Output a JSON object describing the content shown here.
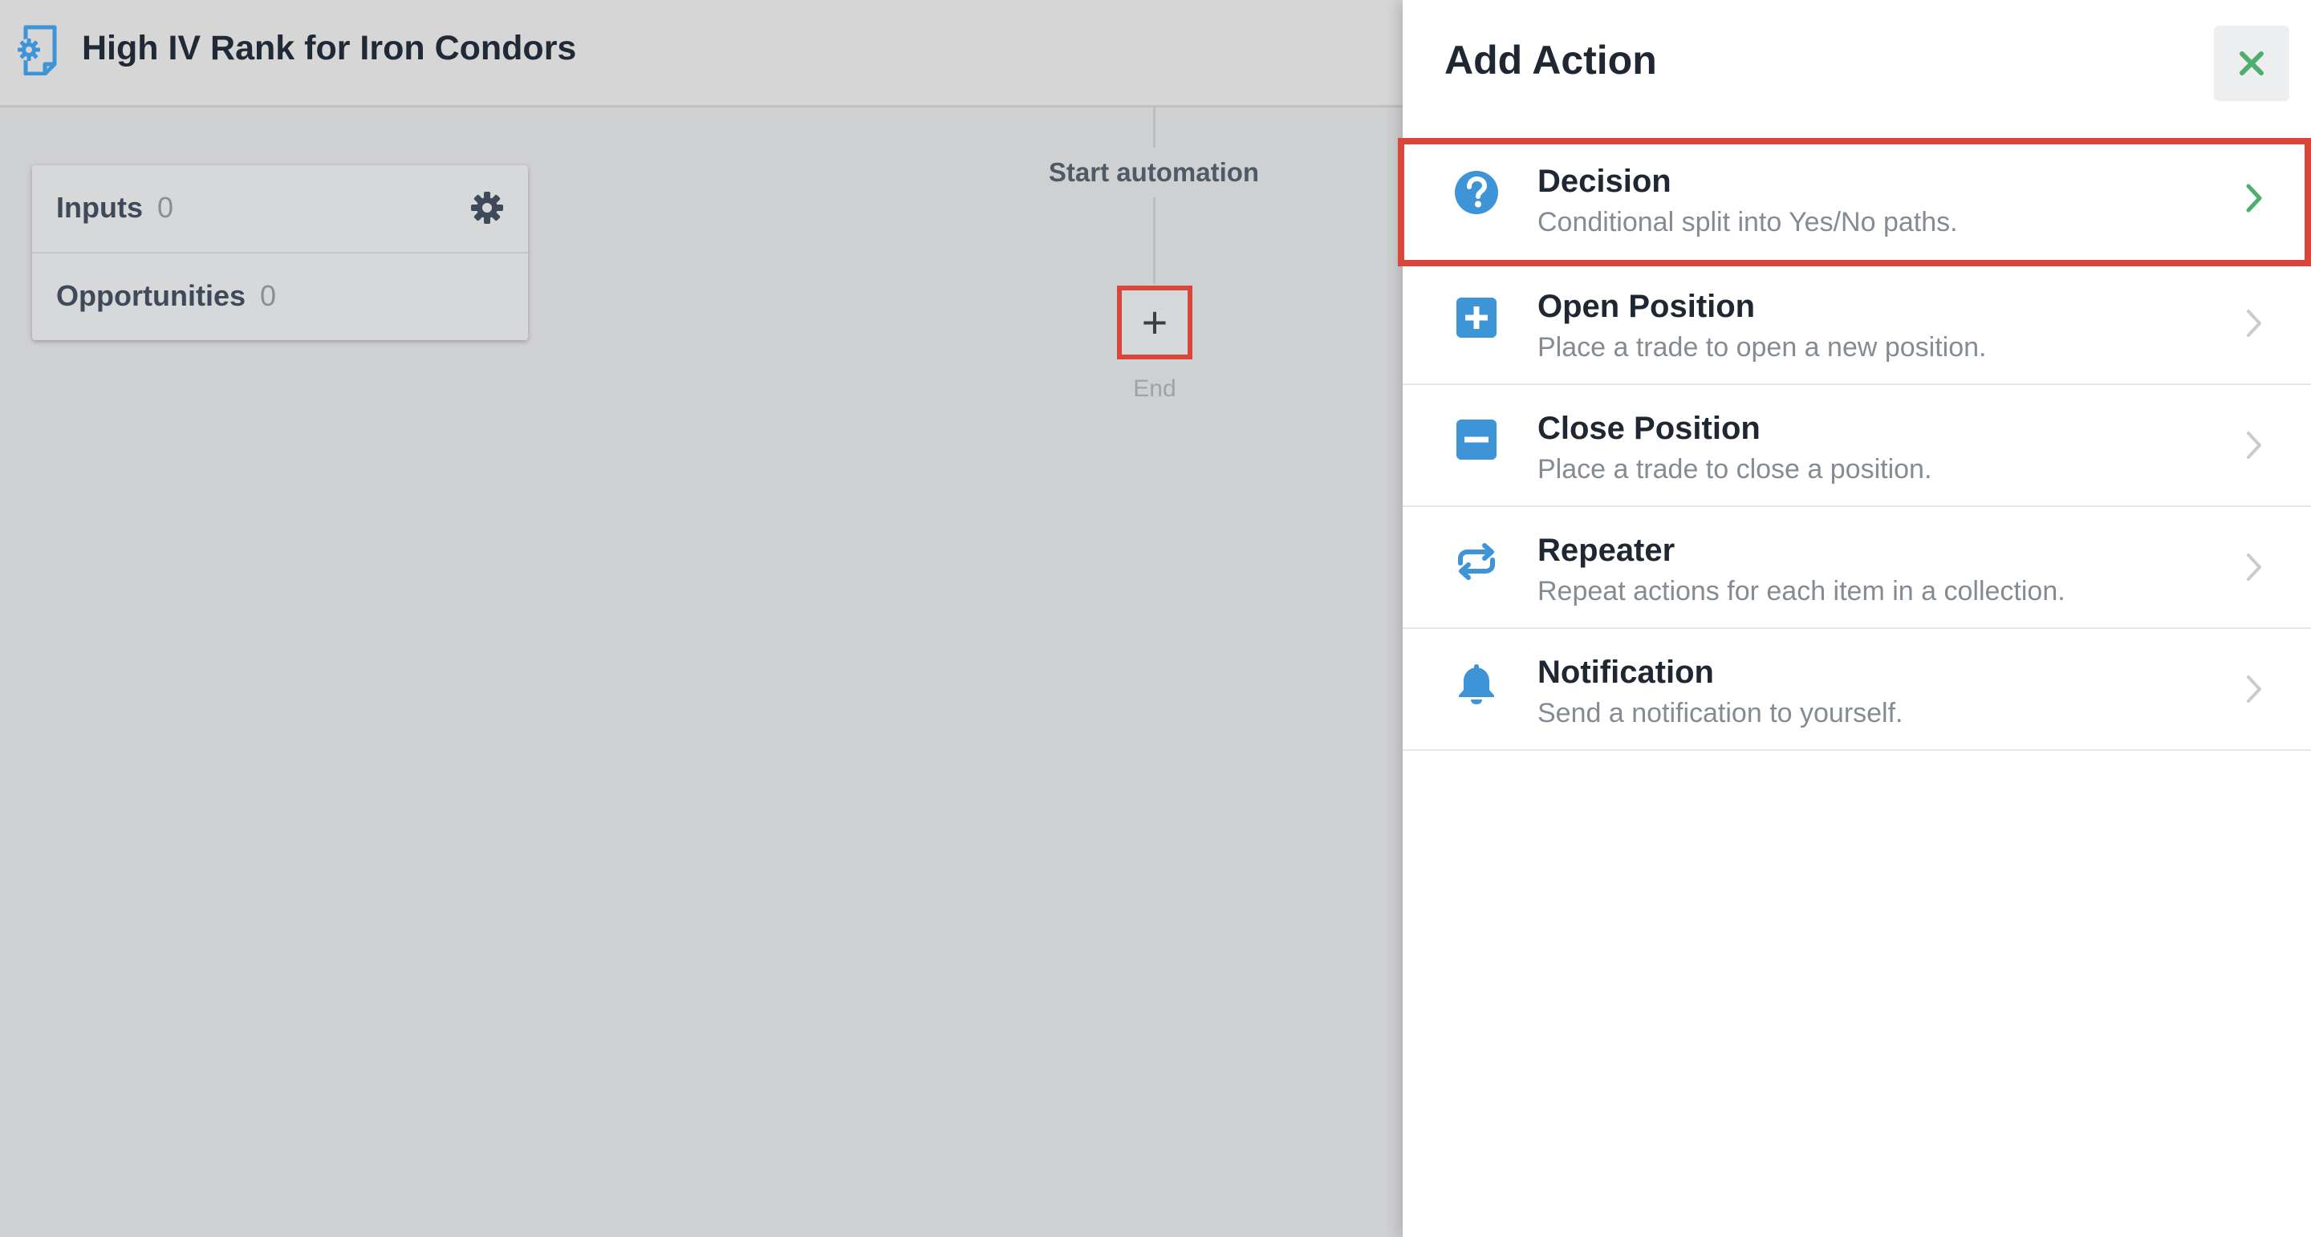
{
  "header": {
    "title": "High IV Rank for Iron Condors",
    "icon": "automation-document-icon"
  },
  "sidebar_card": {
    "inputs": {
      "label": "Inputs",
      "count": "0"
    },
    "opportunities": {
      "label": "Opportunities",
      "count": "0"
    }
  },
  "flow": {
    "start_label": "Start automation",
    "add_symbol": "+",
    "end_label": "End"
  },
  "panel": {
    "title": "Add Action",
    "close_icon": "close-icon",
    "actions": [
      {
        "title": "Decision",
        "description": "Conditional split into Yes/No paths.",
        "icon": "question-circle-icon",
        "selected": true
      },
      {
        "title": "Open Position",
        "description": "Place a trade to open a new position.",
        "icon": "plus-square-icon"
      },
      {
        "title": "Close Position",
        "description": "Place a trade to close a position.",
        "icon": "minus-square-icon"
      },
      {
        "title": "Repeater",
        "description": "Repeat actions for each item in a collection.",
        "icon": "repeat-icon"
      },
      {
        "title": "Notification",
        "description": "Send a notification to yourself.",
        "icon": "bell-icon"
      }
    ]
  },
  "colors": {
    "accent_blue": "#3d94d6",
    "highlight_red": "#d9473b",
    "chevron_green": "#4caf6e"
  }
}
